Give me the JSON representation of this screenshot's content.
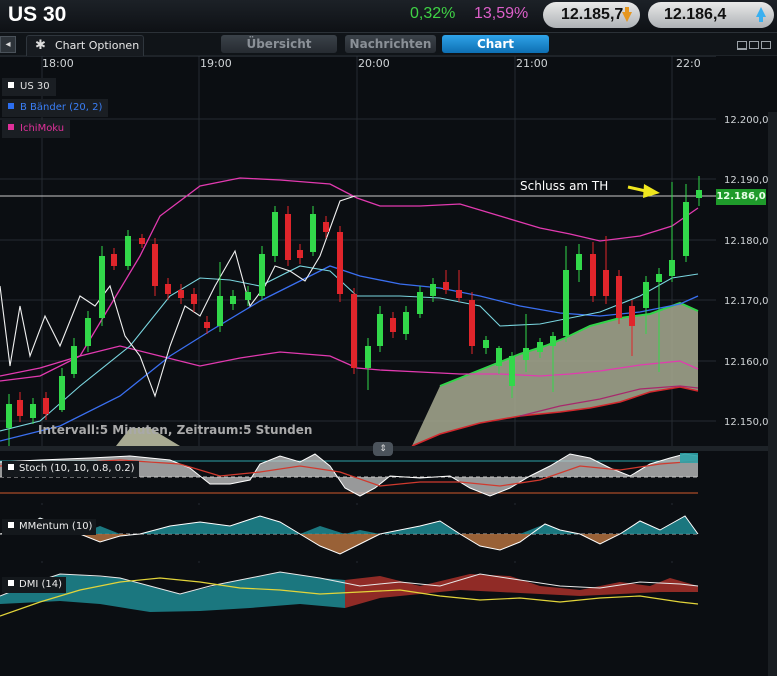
{
  "header": {
    "symbol": "US 30",
    "change_pct": "0,32%",
    "change_pct2": "13,59%",
    "sell_price": "12.185,7",
    "buy_price": "12.186,4",
    "colors": {
      "up": "#3fd245",
      "pink": "#dc5fc9",
      "sell_arrow": "#e6961e",
      "buy_arrow": "#3ab0f0"
    }
  },
  "toolbar": {
    "back_icon": "◂",
    "options_label": "Chart Optionen",
    "tabs": [
      {
        "label": "Übersicht",
        "active": false
      },
      {
        "label": "Nachrichten",
        "active": false
      },
      {
        "label": "Chart",
        "active": true
      }
    ]
  },
  "chart": {
    "time_labels": [
      "18:00",
      "19:00",
      "20:00",
      "21:00",
      "22:0"
    ],
    "price_labels": [
      "12.200,0",
      "12.190,0",
      "12.180,0",
      "12.170,0",
      "12.160,0",
      "12.150,0"
    ],
    "current_price": "12.186,0",
    "annotation": "Schluss am TH",
    "interval_text": "Intervall:5 Minuten, Zeitraum:5 Stunden",
    "splitter_icon": "⇕",
    "legend": [
      {
        "label": "US 30",
        "color": "#ffffff"
      },
      {
        "label": "B Bänder (20, 2)",
        "color": "#2c6ef0"
      },
      {
        "label": "IchiMoku",
        "color": "#e0309a"
      }
    ]
  },
  "indicators": [
    {
      "label": "Stoch (10, 10, 0.8, 0.2)"
    },
    {
      "label": "MMentum (10)"
    },
    {
      "label": "DMI (14)"
    }
  ]
}
